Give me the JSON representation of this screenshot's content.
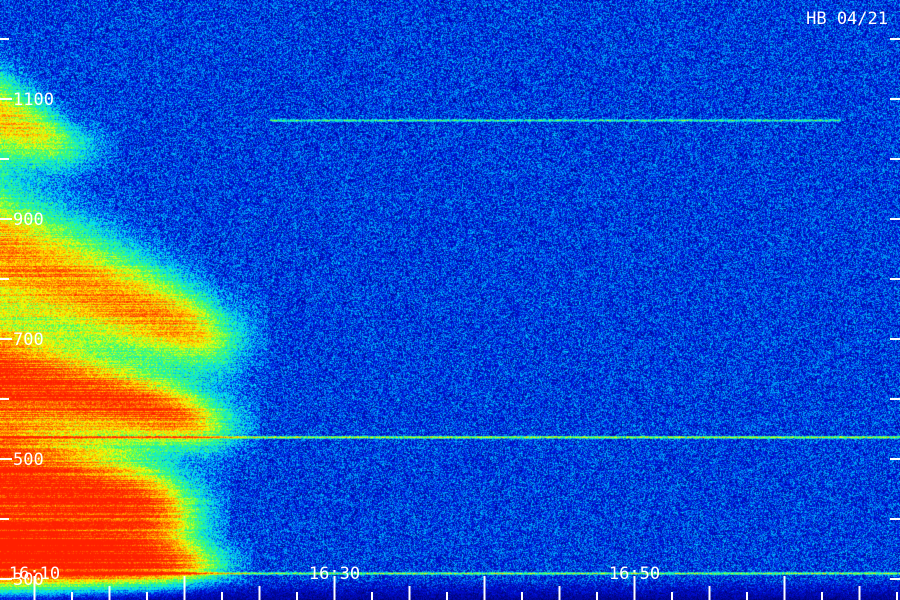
{
  "chart_data": {
    "type": "heatmap",
    "title": "",
    "xlabel": "",
    "ylabel": "",
    "corner_label": "HB 04/21",
    "x_tick_labels": [
      "16:10",
      "16:30",
      "16:50"
    ],
    "x_tick_minutes": [
      10,
      30,
      50
    ],
    "xlim_minutes": [
      7.7,
      67.7
    ],
    "y_tick_labels": [
      "300",
      "500",
      "700",
      "900",
      "1100"
    ],
    "y_tick_values": [
      300,
      500,
      700,
      900,
      1100
    ],
    "ylim": [
      265,
      1265
    ],
    "colormap": [
      "#00005a",
      "#0010e0",
      "#00e0ff",
      "#40ff60",
      "#ffff00",
      "#ff8000",
      "#ff2000"
    ],
    "series": [
      {
        "kind": "tone",
        "start_minute": 7.7,
        "end_minute": 12.5,
        "f_start": 1070,
        "f_end": 1020,
        "width": 70,
        "intensity": 0.62
      },
      {
        "kind": "tone",
        "start_minute": 7.7,
        "end_minute": 22.5,
        "f_start": 840,
        "f_end": 700,
        "width": 110,
        "intensity": 0.75
      },
      {
        "kind": "tone",
        "start_minute": 7.7,
        "end_minute": 22.0,
        "f_start": 640,
        "f_end": 560,
        "width": 80,
        "intensity": 0.9
      },
      {
        "kind": "tone",
        "start_minute": 7.7,
        "end_minute": 20.0,
        "f_start": 460,
        "f_end": 410,
        "width": 110,
        "intensity": 1.0
      },
      {
        "kind": "tone",
        "start_minute": 7.7,
        "end_minute": 21.5,
        "f_start": 330,
        "f_end": 325,
        "width": 60,
        "intensity": 0.85
      },
      {
        "kind": "line",
        "start_minute": 7.7,
        "end_minute": 67.7,
        "frequency": 537,
        "intensity": 0.55
      },
      {
        "kind": "line",
        "start_minute": 27.7,
        "end_minute": 60.7,
        "frequency": 1065,
        "intensity": 0.32
      },
      {
        "kind": "line",
        "start_minute": 7.7,
        "end_minute": 67.7,
        "frequency": 310,
        "intensity": 0.45
      }
    ]
  }
}
